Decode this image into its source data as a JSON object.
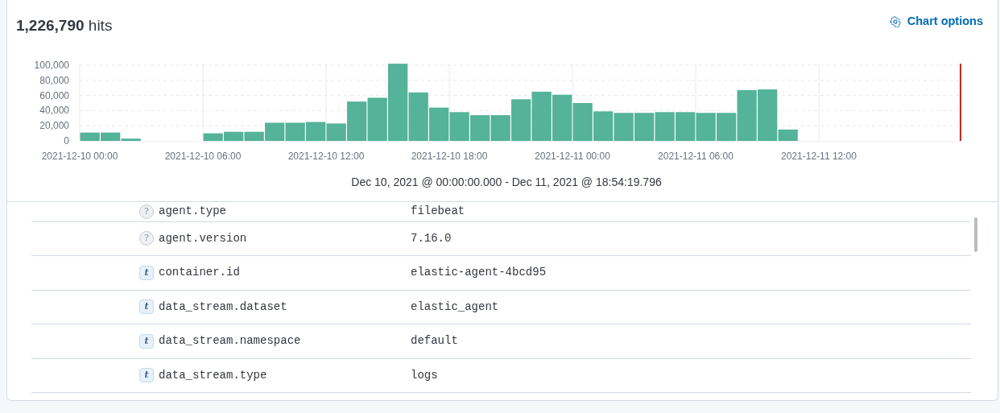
{
  "header": {
    "hits": "**1,226,790** hits",
    "chart_options": "Chart options"
  },
  "histogram": {
    "chart_data": {
      "type": "bar",
      "xlabel": "Dec 10, 2021 @ 00:00:00.000 - Dec 11, 2021 @ 18:54:19.796",
      "categories": [
        "2021-12-10 00:00",
        null,
        null,
        null,
        null,
        null,
        "2021-12-10 06:00",
        null,
        null,
        null,
        null,
        null,
        "2021-12-10 12:00",
        null,
        null,
        null,
        null,
        null,
        "2021-12-10 18:00",
        null,
        null,
        null,
        null,
        null,
        "2021-12-11 00:00",
        null,
        null,
        null,
        null,
        null,
        "2021-12-11 06:00",
        null,
        null,
        null,
        null,
        null,
        "2021-12-11 12:00",
        null,
        null,
        null,
        null,
        null,
        null
      ],
      "series": [
        {
          "color": "#54b399",
          "values": [
            11000,
            11000,
            3000,
            0,
            0,
            0,
            10000,
            12000,
            12000,
            24000,
            24000,
            25000,
            23000,
            52000,
            57000,
            102000,
            64000,
            44000,
            38000,
            34000,
            34000,
            55000,
            65000,
            61000,
            50000,
            39000,
            37000,
            37000,
            38000,
            38000,
            37000,
            37000,
            67000,
            68000,
            15000,
            null,
            null,
            null,
            null,
            null,
            null,
            null,
            null
          ]
        }
      ],
      "ylim": [
        0,
        102000
      ],
      "grid": true,
      "yticks": [
        {
          "value": 0,
          "label": "0"
        },
        {
          "value": 20000,
          "label": "20,000"
        },
        {
          "value": 40000,
          "label": "40,000"
        },
        {
          "value": 60000,
          "label": "60,000"
        },
        {
          "value": 80000,
          "label": "80,000"
        },
        {
          "value": 100000,
          "label": "100,000"
        }
      ]
    }
  },
  "fields": [
    {
      "kind": "unknown",
      "glyph": "?",
      "name": "agent.type",
      "value": "filebeat"
    },
    {
      "kind": "unknown",
      "glyph": "?",
      "name": "agent.version",
      "value": "7.16.0"
    },
    {
      "kind": "string",
      "glyph": "t",
      "name": "container.id",
      "value": "elastic-agent-4bcd95"
    },
    {
      "kind": "string",
      "glyph": "t",
      "name": "data_stream.dataset",
      "value": "elastic_agent"
    },
    {
      "kind": "string",
      "glyph": "t",
      "name": "data_stream.namespace",
      "value": "default"
    },
    {
      "kind": "string",
      "glyph": "t",
      "name": "data_stream.type",
      "value": "logs"
    }
  ]
}
